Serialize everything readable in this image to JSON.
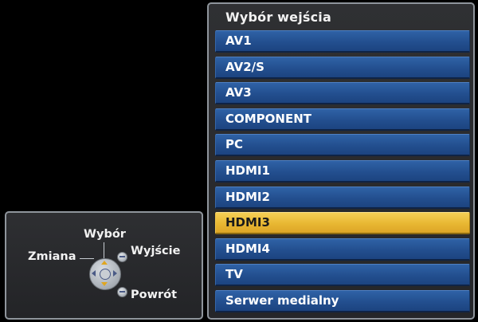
{
  "input_menu": {
    "title": "Wybór wejścia",
    "items": [
      {
        "label": "AV1",
        "selected": false
      },
      {
        "label": "AV2/S",
        "selected": false
      },
      {
        "label": "AV3",
        "selected": false
      },
      {
        "label": "COMPONENT",
        "selected": false
      },
      {
        "label": "PC",
        "selected": false
      },
      {
        "label": "HDMI1",
        "selected": false
      },
      {
        "label": "HDMI2",
        "selected": false
      },
      {
        "label": "HDMI3",
        "selected": true
      },
      {
        "label": "HDMI4",
        "selected": false
      },
      {
        "label": "TV",
        "selected": false
      },
      {
        "label": "Serwer medialny",
        "selected": false
      }
    ]
  },
  "remote_help": {
    "select_label": "Wybór",
    "change_label": "Zmiana",
    "exit_label": "Wyjście",
    "return_label": "Powrót",
    "icons": [
      "dpad-icon",
      "exit-button-icon",
      "return-button-icon"
    ]
  },
  "colors": {
    "item_background": "#234f8f",
    "selected_background": "#e8b732",
    "panel_border": "#8f959c",
    "screen_background": "#000000"
  }
}
